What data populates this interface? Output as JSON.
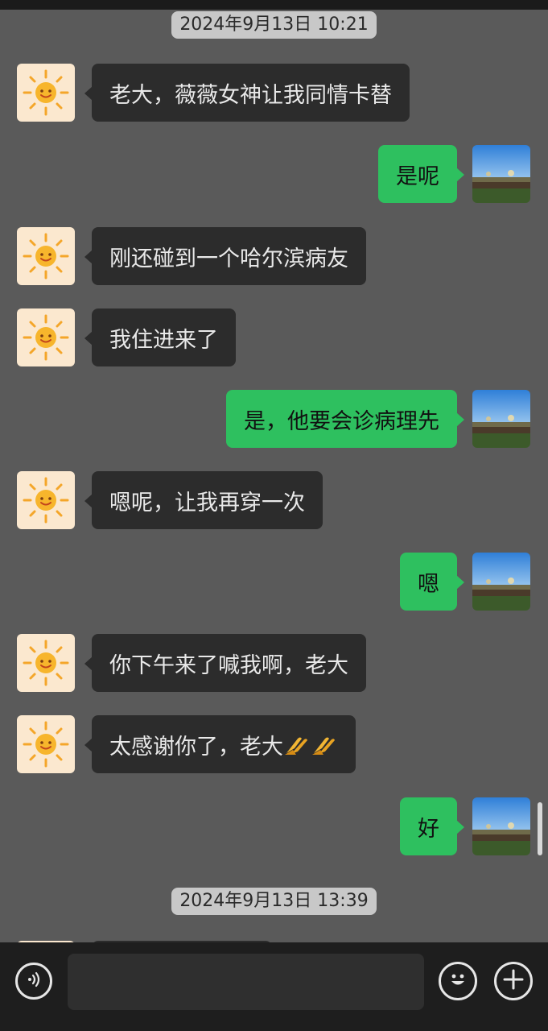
{
  "chat": {
    "timestamps": [
      "2024年9月13日 10:21",
      "2024年9月13日 13:39"
    ],
    "messages": [
      {
        "side": "left",
        "text": "老大，薇薇女神让我同情卡替"
      },
      {
        "side": "right",
        "text": "是呢"
      },
      {
        "side": "left",
        "text": "刚还碰到一个哈尔滨病友"
      },
      {
        "side": "left",
        "text": "我住进来了"
      },
      {
        "side": "right",
        "text": "是，他要会诊病理先"
      },
      {
        "side": "left",
        "text": "嗯呢，让我再穿一次"
      },
      {
        "side": "right",
        "text": "嗯"
      },
      {
        "side": "left",
        "text": "你下午来了喊我啊，老大"
      },
      {
        "side": "left",
        "text": "太感谢你了，老大🫡🫡",
        "emoji": "folded-hands",
        "emoji_count": 2,
        "text_prefix": "太感谢你了，老大"
      },
      {
        "side": "right",
        "text": "好"
      }
    ]
  },
  "input": {
    "text": "",
    "voice_icon": "voice-icon",
    "emoji_icon": "emoji-icon",
    "plus_icon": "plus-icon"
  },
  "colors": {
    "background": "#5a5a5a",
    "left_bubble": "#2c2c2c",
    "right_bubble": "#2ec05f",
    "timestamp_pill": "#c8c8c8",
    "input_bar": "#1e1e1e"
  }
}
